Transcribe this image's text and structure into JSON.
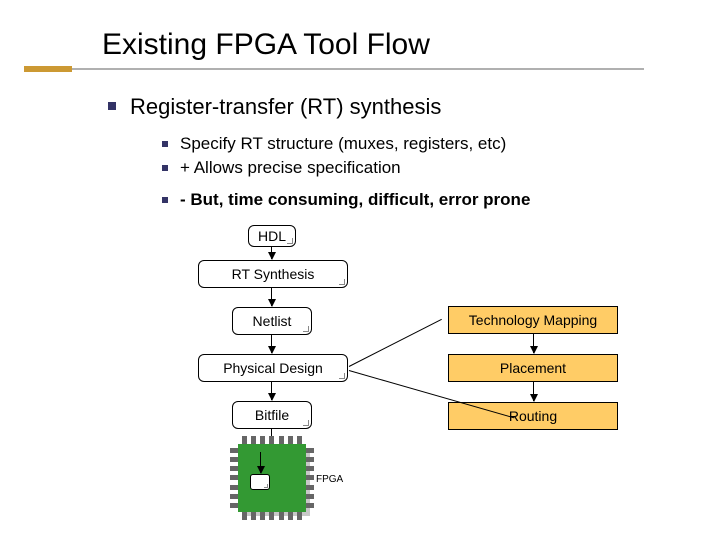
{
  "title": "Existing FPGA Tool Flow",
  "bullets": {
    "main": "Register-transfer (RT) synthesis",
    "sub1": "Specify RT structure (muxes, registers, etc)",
    "sub2": "+ Allows precise specification",
    "sub3": "- But, time consuming, difficult, error prone"
  },
  "flow": {
    "hdl": "HDL",
    "rt_syn": "RT Synthesis",
    "netlist": "Netlist",
    "phys": "Physical Design",
    "bitfile": "Bitfile",
    "fpga": "FPGA",
    "tech_map": "Technology Mapping",
    "placement": "Placement",
    "routing": "Routing"
  }
}
